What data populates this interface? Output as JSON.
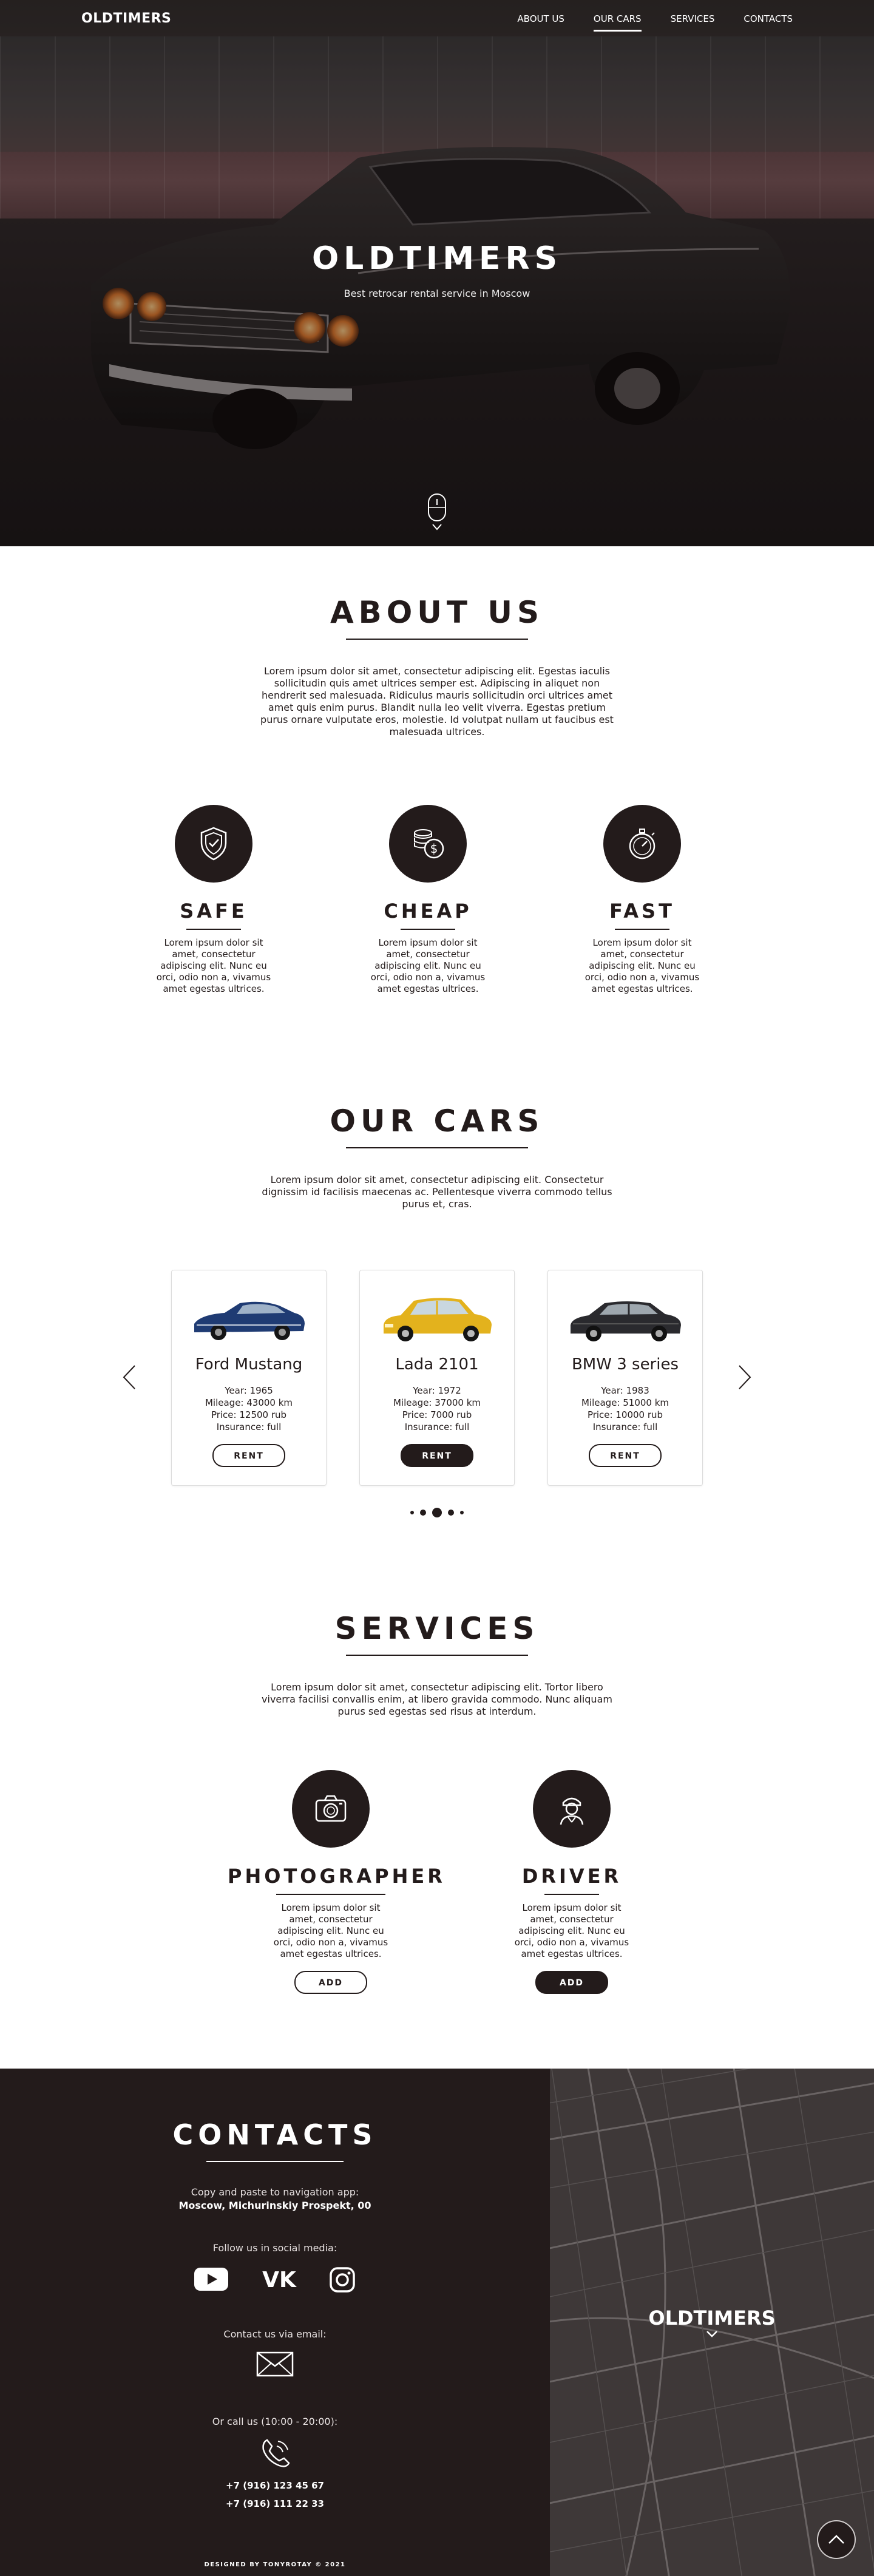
{
  "brand": "OLDTIMERS",
  "nav": {
    "items": [
      {
        "label": "ABOUT US",
        "active": false
      },
      {
        "label": "OUR CARS",
        "active": true
      },
      {
        "label": "SERVICES",
        "active": false
      },
      {
        "label": "CONTACTS",
        "active": false
      }
    ]
  },
  "hero": {
    "title": "OLDTIMERS",
    "subtitle": "Best retrocar rental service in Moscow"
  },
  "about": {
    "title": "ABOUT US",
    "text": "Lorem ipsum dolor sit amet, consectetur adipiscing elit. Egestas iaculis sollicitudin quis amet ultrices semper est. Adipiscing in aliquet non hendrerit sed malesuada. Ridiculus mauris sollicitudin orci ultrices amet amet quis enim purus. Blandit nulla leo velit viverra. Egestas pretium purus ornare vulputate eros, molestie. Id volutpat nullam ut faucibus est malesuada ultrices.",
    "features": [
      {
        "name": "SAFE",
        "icon": "shield-icon",
        "text": "Lorem ipsum dolor sit amet, consectetur adipiscing elit. Nunc eu orci, odio non a, vivamus amet egestas ultrices."
      },
      {
        "name": "CHEAP",
        "icon": "coins-icon",
        "text": "Lorem ipsum dolor sit amet, consectetur adipiscing elit. Nunc eu orci, odio non a, vivamus amet egestas ultrices."
      },
      {
        "name": "FAST",
        "icon": "stopwatch-icon",
        "text": "Lorem ipsum dolor sit amet, consectetur adipiscing elit. Nunc eu orci, odio non a, vivamus amet egestas ultrices."
      }
    ]
  },
  "cars": {
    "title": "OUR CARS",
    "text": "Lorem ipsum dolor sit amet, consectetur adipiscing elit. Consectetur dignissim id facilisis maecenas ac. Pellentesque viverra commodo tellus purus et, cras.",
    "items": [
      {
        "name": "Ford Mustang",
        "year": "Year: 1965",
        "mileage": "Mileage: 43000 km",
        "price": "Price: 12500 rub",
        "insurance": "Insurance: full",
        "button": "RENT",
        "color": "#1f3b73",
        "highlighted": false
      },
      {
        "name": "Lada 2101",
        "year": "Year: 1972",
        "mileage": "Mileage: 37000 km",
        "price": "Price: 7000 rub",
        "insurance": "Insurance: full",
        "button": "RENT",
        "color": "#e3b21d",
        "highlighted": true
      },
      {
        "name": "BMW 3 series",
        "year": "Year: 1983",
        "mileage": "Mileage: 51000 km",
        "price": "Price: 10000 rub",
        "insurance": "Insurance: full",
        "button": "RENT",
        "color": "#2a2a2e",
        "highlighted": false
      }
    ],
    "pagination": {
      "count": 5,
      "active_index": 2
    }
  },
  "services": {
    "title": "SERVICES",
    "text": "Lorem ipsum dolor sit amet, consectetur adipiscing elit. Tortor libero viverra facilisi convallis enim, at libero gravida commodo. Nunc aliquam purus sed egestas sed risus at interdum.",
    "items": [
      {
        "name": "PHOTOGRAPHER",
        "icon": "camera-icon",
        "text": "Lorem ipsum dolor sit amet, consectetur adipiscing elit. Nunc eu orci, odio non a, vivamus amet egestas ultrices.",
        "button": "ADD",
        "filled": false
      },
      {
        "name": "DRIVER",
        "icon": "driver-icon",
        "text": "Lorem ipsum dolor sit amet, consectetur adipiscing elit. Nunc eu orci, odio non a, vivamus amet egestas ultrices.",
        "button": "ADD",
        "filled": true
      }
    ]
  },
  "contacts": {
    "title": "CONTACTS",
    "address_label": "Copy and paste to navigation app:",
    "address": "Moscow, Michurinskiy Prospekt, 00",
    "social_label": "Follow us in social media:",
    "social_icons": [
      "youtube-icon",
      "vk-icon",
      "instagram-icon"
    ],
    "email_label": "Contact us via email:",
    "phone_label": "Or call us (10:00 - 20:00):",
    "phones": [
      "+7 (916) 123 45 67",
      "+7 (916) 111 22 33"
    ],
    "map_logo": "OLDTIMERS",
    "credit": "DESIGNED BY TONYROTAY © 2021"
  },
  "colors": {
    "primary": "#231b1b",
    "white": "#ffffff",
    "map": "#3e3838"
  }
}
